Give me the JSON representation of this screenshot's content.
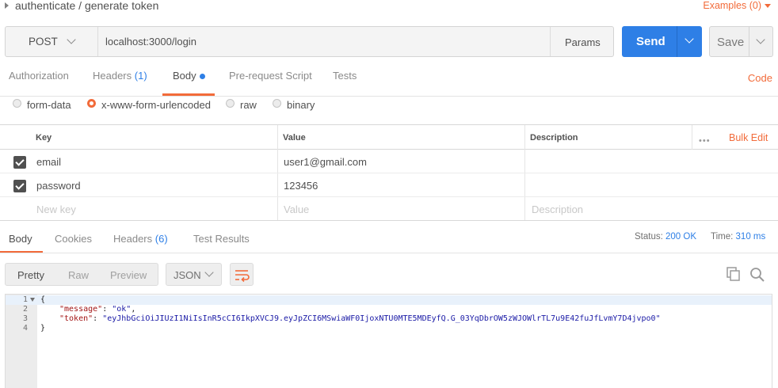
{
  "header": {
    "title": "authenticate / generate token",
    "examples_label": "Examples (0)"
  },
  "request": {
    "method": "POST",
    "url": "localhost:3000/login",
    "params_label": "Params",
    "send_label": "Send",
    "save_label": "Save"
  },
  "request_tabs": {
    "authorization": "Authorization",
    "headers": "Headers",
    "headers_count": "(1)",
    "body": "Body",
    "prerequest": "Pre-request Script",
    "tests": "Tests",
    "code": "Code"
  },
  "body_types": {
    "form_data": "form-data",
    "urlencoded": "x-www-form-urlencoded",
    "raw": "raw",
    "binary": "binary",
    "selected": "x-www-form-urlencoded"
  },
  "kv_table": {
    "headers": {
      "key": "Key",
      "value": "Value",
      "description": "Description"
    },
    "more_label": "•••",
    "bulk_edit": "Bulk Edit",
    "rows": [
      {
        "checked": true,
        "key": "email",
        "value": "user1@gmail.com",
        "description": ""
      },
      {
        "checked": true,
        "key": "password",
        "value": "123456",
        "description": ""
      }
    ],
    "placeholders": {
      "key": "New key",
      "value": "Value",
      "description": "Description"
    }
  },
  "response_tabs": {
    "body": "Body",
    "cookies": "Cookies",
    "headers": "Headers",
    "headers_count": "(6)",
    "test_results": "Test Results",
    "status_label": "Status:",
    "status_value": "200 OK",
    "time_label": "Time:",
    "time_value": "310 ms"
  },
  "response_view": {
    "pretty": "Pretty",
    "raw": "Raw",
    "preview": "Preview",
    "format": "JSON"
  },
  "response_body": {
    "lines": [
      {
        "num": "1",
        "open": "{"
      },
      {
        "num": "2",
        "key": "\"message\"",
        "value": "\"ok\"",
        "sep": ": ",
        "end": ","
      },
      {
        "num": "3",
        "key": "\"token\"",
        "value": "\"eyJhbGciOiJIUzI1NiIsInR5cCI6IkpXVCJ9.eyJpZCI6MSwiaWF0IjoxNTU0MTE5MDEyfQ.G_03YqDbrOW5zWJOWlrTL7u9E42fuJfLvmY7D4jvpo0\"",
        "sep": ": ",
        "end": ""
      },
      {
        "num": "4",
        "close": "}"
      }
    ]
  },
  "colors": {
    "accent": "#f26b3a",
    "primary": "#2e7fe6"
  }
}
